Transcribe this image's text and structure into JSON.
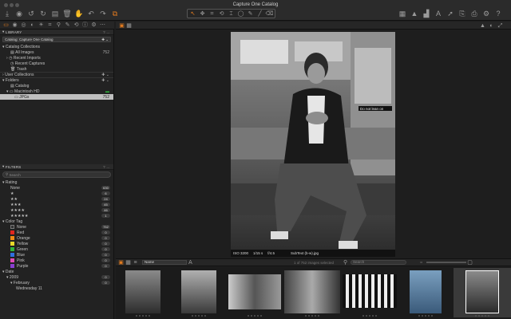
{
  "window": {
    "title": "Capture One Catalog"
  },
  "toolbar": {
    "left_icons": [
      "import-icon",
      "camera-icon",
      "rotate-left-icon",
      "rotate-right-icon",
      "delete-icon",
      "trash-icon",
      "undo-icon",
      "undo-alt-icon",
      "redo-icon",
      "edit-icon"
    ],
    "cursor_tools": [
      "select-cursor-icon",
      "pan-cursor-icon",
      "crop-cursor-icon",
      "straighten-cursor-icon",
      "keystone-cursor-icon",
      "rotate-cursor-icon",
      "spot-cursor-icon",
      "picker-cursor-icon",
      "brush-cursor-icon",
      "erase-cursor-icon"
    ],
    "right_icons": [
      "grid-icon",
      "warning-icon",
      "histogram-icon",
      "text-icon",
      "arrow-icon",
      "copy-icon",
      "print-icon",
      "settings-icon",
      "help-icon"
    ]
  },
  "library": {
    "header": "LIBRARY",
    "catalog_select": "Catalog: Capture One Catalog",
    "catalog_collections_label": "Catalog Collections",
    "collections": [
      {
        "label": "All Images",
        "count": "752",
        "icon": "images-icon"
      },
      {
        "label": "Recent Imports",
        "count": "",
        "icon": "clock-icon"
      },
      {
        "label": "Recent Captures",
        "count": "",
        "icon": "capture-icon"
      },
      {
        "label": "Trash",
        "count": "",
        "icon": "trash-icon"
      }
    ],
    "user_collections_label": "User Collections",
    "folders_label": "Folders",
    "folders": [
      {
        "label": "Catalog",
        "count": "",
        "icon": "catalog-icon"
      },
      {
        "label": "Macintosh HD",
        "count": "",
        "icon": "disk-icon"
      },
      {
        "label": "JPGs",
        "count": "752",
        "icon": "folder-icon"
      }
    ]
  },
  "filters": {
    "header": "FILTERS",
    "search_placeholder": "Search",
    "rating_label": "Rating",
    "ratings": [
      {
        "label": "None",
        "count": "630"
      },
      {
        "label": "★",
        "count": "6"
      },
      {
        "label": "★★",
        "count": "24"
      },
      {
        "label": "★★★",
        "count": "45"
      },
      {
        "label": "★★★★",
        "count": "46"
      },
      {
        "label": "★★★★★",
        "count": "1"
      }
    ],
    "color_tag_label": "Color Tag",
    "color_tags": [
      {
        "label": "None",
        "count": "752",
        "color": "#333333"
      },
      {
        "label": "Red",
        "count": "0",
        "color": "#e0261f"
      },
      {
        "label": "Orange",
        "count": "0",
        "color": "#ee8a16"
      },
      {
        "label": "Yellow",
        "count": "0",
        "color": "#e8d82a"
      },
      {
        "label": "Green",
        "count": "0",
        "color": "#2fb33b"
      },
      {
        "label": "Blue",
        "count": "0",
        "color": "#2f6fe0"
      },
      {
        "label": "Pink",
        "count": "0",
        "color": "#e04bb6"
      },
      {
        "label": "Purple",
        "count": "0",
        "color": "#8a3fd1"
      }
    ],
    "date_label": "Date",
    "dates": [
      {
        "label": "2009",
        "count": "0"
      },
      {
        "label": "February",
        "count": "0"
      },
      {
        "label": "Wednesday 11",
        "count": ""
      }
    ]
  },
  "viewer": {
    "photo_meta": {
      "iso": "ISO 3200",
      "shutter": "1/15 s",
      "aperture": "f/4.5",
      "filename": "SubText (b-w).jpg"
    },
    "photo_sign": "Do not lean on"
  },
  "browser": {
    "sort_select": "Name",
    "count_text": "1 of 752 images selected",
    "search_placeholder": "Search",
    "thumbnails": [
      {
        "selected": false
      },
      {
        "selected": false
      },
      {
        "selected": false
      },
      {
        "selected": false
      },
      {
        "selected": false
      },
      {
        "selected": false
      },
      {
        "selected": false
      }
    ]
  },
  "colors": {
    "accent": "#e07a1f",
    "panel": "#222222",
    "selection": "#bfbfbf"
  }
}
